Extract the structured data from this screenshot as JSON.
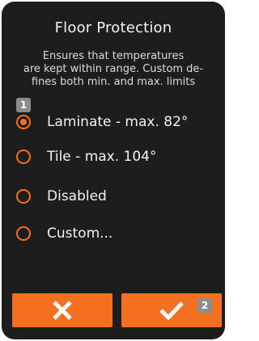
{
  "dialog": {
    "title": "Floor Protection",
    "description_lines": [
      "Ensures that temperatures",
      "are kept within range. Custom de-",
      "fines both min. and max. limits"
    ]
  },
  "badges": {
    "options": "1",
    "confirm": "2"
  },
  "options": [
    {
      "label": "Laminate - max. 82°",
      "selected": true
    },
    {
      "label": "Tile - max. 104°",
      "selected": false
    },
    {
      "label": "Disabled",
      "selected": false
    },
    {
      "label": "Custom...",
      "selected": false
    }
  ],
  "buttons": {
    "cancel_icon": "close-icon",
    "confirm_icon": "checkmark-icon"
  },
  "colors": {
    "accent": "#f37021",
    "background": "#1d1d1d",
    "badge": "#8c8c8c"
  }
}
